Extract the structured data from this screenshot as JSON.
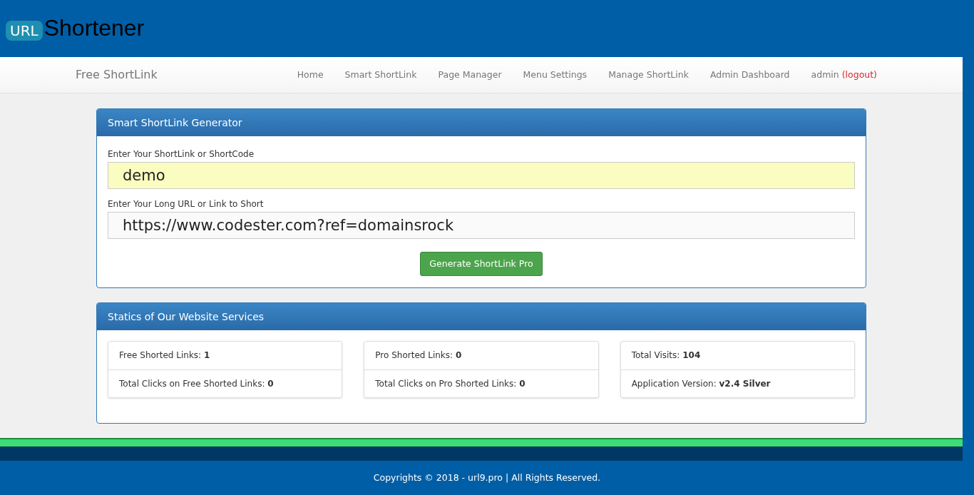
{
  "logo": {
    "badge": "URL",
    "text": "Shortener"
  },
  "navbar": {
    "brand": "Free ShortLink",
    "items": [
      {
        "label": "Home"
      },
      {
        "label": "Smart ShortLink"
      },
      {
        "label": "Page Manager"
      },
      {
        "label": "Menu Settings"
      },
      {
        "label": "Manage ShortLink"
      },
      {
        "label": "Admin Dashboard"
      }
    ],
    "user": "admin",
    "logout": "(logout)"
  },
  "generator": {
    "title": "Smart ShortLink Generator",
    "fields": [
      {
        "label": "Enter Your ShortLink or ShortCode",
        "value": "demo",
        "highlighted": true
      },
      {
        "label": "Enter Your Long URL or Link to Short",
        "value": "https://www.codester.com?ref=domainsrock",
        "highlighted": false
      }
    ],
    "button": "Generate ShortLink Pro"
  },
  "statistics": {
    "title": "Statics of Our Website Services",
    "groups": [
      [
        "Free Shorted Links: **1**",
        "Total Clicks on Free Shorted Links: **0**"
      ],
      [
        "Pro Shorted Links: **0**",
        "Total Clicks on Pro Shorted Links: **0**"
      ],
      [
        "Total Visits: **104**",
        "Application Version: **v2.4 Silver**"
      ]
    ]
  },
  "footer": "Copyrights © 2018 - url9.pro | All Rights Reserved."
}
